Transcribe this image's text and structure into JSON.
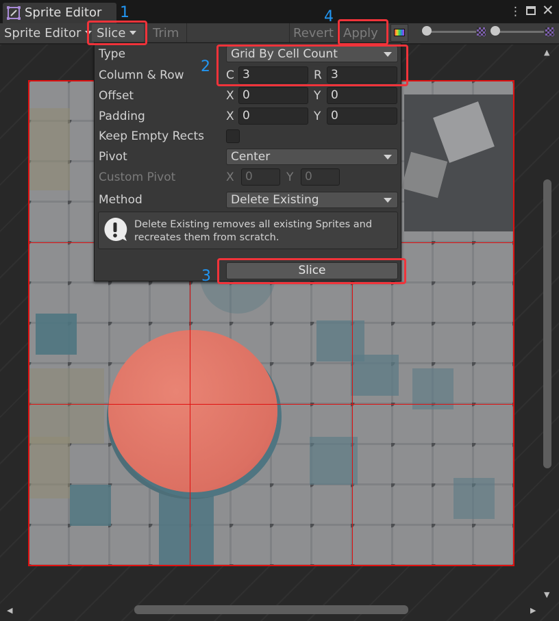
{
  "window": {
    "tab_title": "Sprite Editor",
    "menu_glyph": "⋮",
    "close_glyph": "✕"
  },
  "toolbar": {
    "mode_label": "Sprite Editor",
    "slice_label": "Slice",
    "trim_label": "Trim",
    "revert_label": "Revert",
    "apply_label": "Apply"
  },
  "slice_panel": {
    "type_label": "Type",
    "type_value": "Grid By Cell Count",
    "column_row_label": "Column & Row",
    "column_prefix": "C",
    "column_value": "3",
    "row_prefix": "R",
    "row_value": "3",
    "offset_label": "Offset",
    "offset_x_prefix": "X",
    "offset_x": "0",
    "offset_y_prefix": "Y",
    "offset_y": "0",
    "padding_label": "Padding",
    "padding_x_prefix": "X",
    "padding_x": "0",
    "padding_y_prefix": "Y",
    "padding_y": "0",
    "keep_empty_label": "Keep Empty Rects",
    "keep_empty_checked": false,
    "pivot_label": "Pivot",
    "pivot_value": "Center",
    "custom_pivot_label": "Custom Pivot",
    "custom_pivot_x_prefix": "X",
    "custom_pivot_x": "0",
    "custom_pivot_y_prefix": "Y",
    "custom_pivot_y": "0",
    "method_label": "Method",
    "method_value": "Delete Existing",
    "help_text": "Delete Existing removes all existing Sprites and recreates them from scratch.",
    "slice_button_label": "Slice"
  },
  "annotations": {
    "step1": "1",
    "step2": "2",
    "step3": "3",
    "step4": "4"
  },
  "colors": {
    "highlight": "#f0333a",
    "annotation_number": "#2196f3",
    "grid_line": "#e01010"
  },
  "icons": [
    "sprite-editor-icon",
    "window-menu-icon",
    "maximize-icon",
    "close-icon",
    "color-channel-icon",
    "alpha-checker-icon",
    "info-icon"
  ]
}
